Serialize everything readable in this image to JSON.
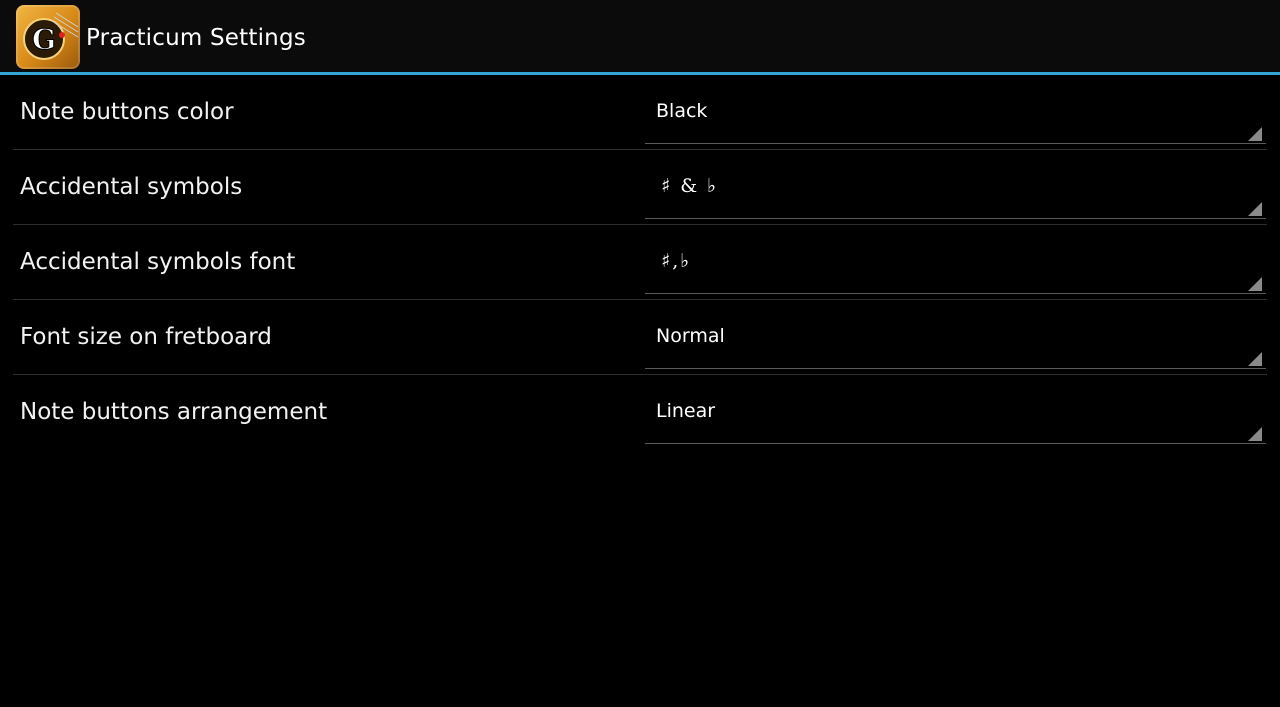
{
  "action_bar": {
    "title": "Practicum Settings",
    "app_icon": "guitar-app-icon",
    "accent_color": "#33a5d4"
  },
  "settings": [
    {
      "label": "Note buttons color",
      "value": "Black"
    },
    {
      "label": "Accidental symbols",
      "value": "♯ & ♭"
    },
    {
      "label": "Accidental symbols font",
      "value": "♯,♭"
    },
    {
      "label": "Font size on fretboard",
      "value": "Normal"
    },
    {
      "label": "Note buttons arrangement",
      "value": "Linear"
    }
  ]
}
